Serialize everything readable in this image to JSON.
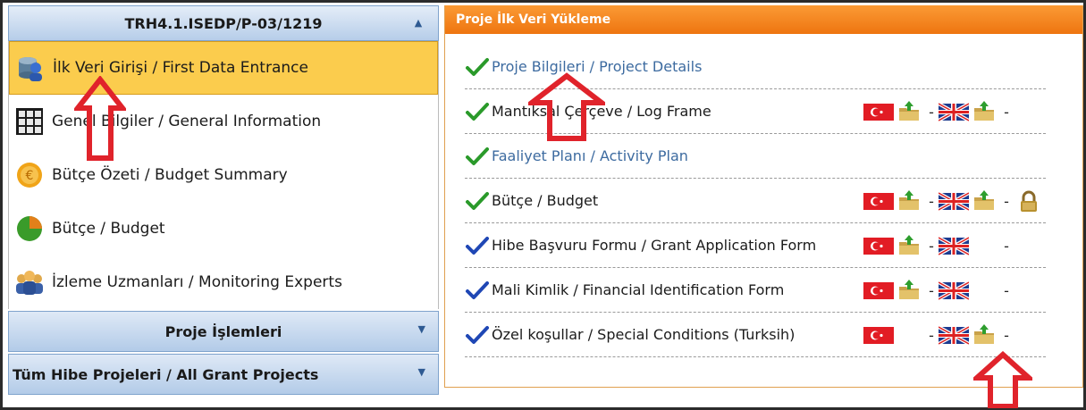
{
  "sidebar": {
    "project_code": "TRH4.1.ISEDP/P-03/1219",
    "items": [
      {
        "label": "İlk Veri Girişi / First Data Entrance",
        "icon": "database-user-icon",
        "active": true
      },
      {
        "label": "Genel Bilgiler / General Information",
        "icon": "grid-icon",
        "active": false
      },
      {
        "label": "Bütçe Özeti / Budget Summary",
        "icon": "coin-icon",
        "active": false
      },
      {
        "label": "Bütçe / Budget",
        "icon": "pie-chart-icon",
        "active": false
      },
      {
        "label": "İzleme Uzmanları / Monitoring Experts",
        "icon": "people-icon",
        "active": false
      }
    ],
    "section_operations": "Proje İşlemleri",
    "section_all_projects": "Tüm Hibe Projeleri / All Grant Projects"
  },
  "panel": {
    "title": "Proje İlk Veri Yükleme",
    "rows": [
      {
        "label": "Proje Bilgileri / Project Details",
        "check": "green",
        "link": true,
        "icons": []
      },
      {
        "label": "Mantıksal Çerçeve / Log Frame",
        "check": "green",
        "link": false,
        "icons": [
          "tr-flag",
          "upload-folder",
          "dash",
          "uk-flag",
          "upload-folder",
          "dash"
        ]
      },
      {
        "label": "Faaliyet Planı / Activity Plan",
        "check": "green",
        "link": true,
        "icons": []
      },
      {
        "label": "Bütçe / Budget",
        "check": "green",
        "link": false,
        "icons": [
          "tr-flag",
          "upload-folder",
          "dash",
          "uk-flag",
          "upload-folder",
          "dash",
          "lock"
        ]
      },
      {
        "label": "Hibe Başvuru Formu / Grant Application Form",
        "check": "blue",
        "link": false,
        "icons": [
          "tr-flag",
          "upload-folder",
          "dash",
          "uk-flag",
          "gap",
          "dash"
        ]
      },
      {
        "label": "Mali Kimlik / Financial Identification Form",
        "check": "blue",
        "link": false,
        "icons": [
          "tr-flag",
          "upload-folder",
          "dash",
          "uk-flag",
          "gap",
          "dash"
        ]
      },
      {
        "label": "Özel koşullar / Special Conditions (Turksih)",
        "check": "blue",
        "link": false,
        "icons": [
          "tr-flag",
          "gap",
          "dash",
          "uk-flag",
          "upload-folder",
          "dash"
        ]
      }
    ]
  },
  "colors": {
    "active_item_bg": "#fbcc4d",
    "panel_header": "#ee7510",
    "accordion_blue": "#b6cde9",
    "check_green": "#2a9a2a",
    "check_blue": "#1f47b5",
    "annotation_arrow": "#e0232b"
  }
}
